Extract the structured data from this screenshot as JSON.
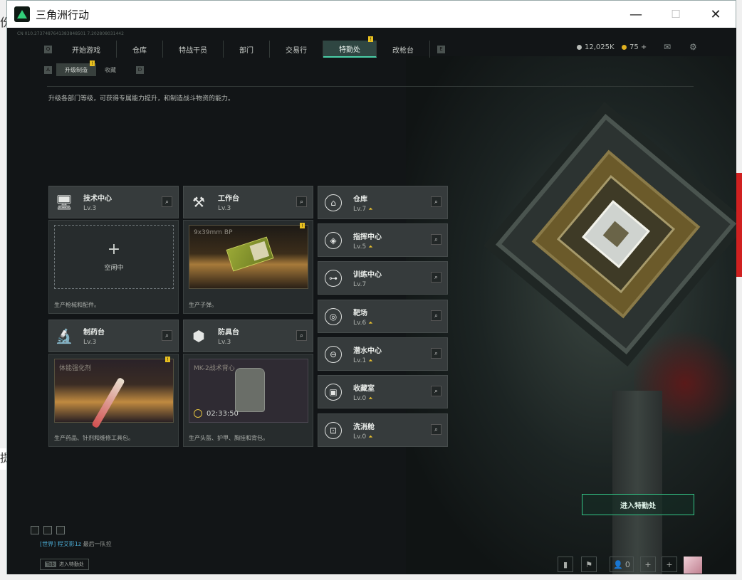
{
  "window": {
    "title": "三角洲行动",
    "minimize": "—",
    "maximize": "☐",
    "close": "✕"
  },
  "build_id": "CN 010.2737487641383848501 7.202808031442",
  "nav": {
    "key_left": "Q",
    "key_right": "E",
    "items": [
      "开始游戏",
      "仓库",
      "特战干员",
      "部门",
      "交易行",
      "特勤处",
      "改枪台"
    ],
    "active": "特勤处",
    "badge": "!"
  },
  "currency": {
    "main": "12,025K",
    "main_color": "#b8bcb8",
    "secondary": "75 +",
    "secondary_color": "#e0b020"
  },
  "subnav": {
    "key_left": "A",
    "key_right": "D",
    "items": [
      "升级制造",
      "收藏"
    ],
    "badge": "!"
  },
  "description": "升级各部门等级，可获得专属能力提升，和制造战斗物资的能力。",
  "workshops": [
    {
      "name": "技术中心",
      "level": "Lv.3",
      "icon": "computer-icon",
      "slot_state": "空闲中",
      "plus": "+",
      "footnote": "生产枪械和配件。"
    },
    {
      "name": "工作台",
      "level": "Lv.3",
      "icon": "tools-icon",
      "product": "9x39mm BP",
      "footnote": "生产子弹。"
    },
    {
      "name": "制药台",
      "level": "Lv.3",
      "icon": "microscope-icon",
      "product": "体能强化剂",
      "footnote": "生产药品、针剂和维修工具包。"
    },
    {
      "name": "防具台",
      "level": "Lv.3",
      "icon": "cubes-icon",
      "product": "MK-2战术背心",
      "timer": "02:33:50",
      "footnote": "生产头盔、护甲、胸挂和背包。"
    }
  ],
  "departments": [
    {
      "name": "仓库",
      "level": "Lv.7",
      "upgrade": true
    },
    {
      "name": "指挥中心",
      "level": "Lv.5",
      "upgrade": true
    },
    {
      "name": "训练中心",
      "level": "Lv.7",
      "upgrade": false
    },
    {
      "name": "靶场",
      "level": "Lv.6",
      "upgrade": true
    },
    {
      "name": "潜水中心",
      "level": "Lv.1",
      "upgrade": true
    },
    {
      "name": "收藏室",
      "level": "Lv.0",
      "upgrade": true
    },
    {
      "name": "洗消舱",
      "level": "Lv.0",
      "upgrade": true
    }
  ],
  "enter_button": "进入特勤处",
  "chat": {
    "channel": "[世界]",
    "user": "程艾影1z",
    "message": "最后一队拉"
  },
  "tab_hint": {
    "key": "Tab",
    "label": "进入特勤处"
  },
  "friends_count": "0",
  "accent_color": "#34c486"
}
